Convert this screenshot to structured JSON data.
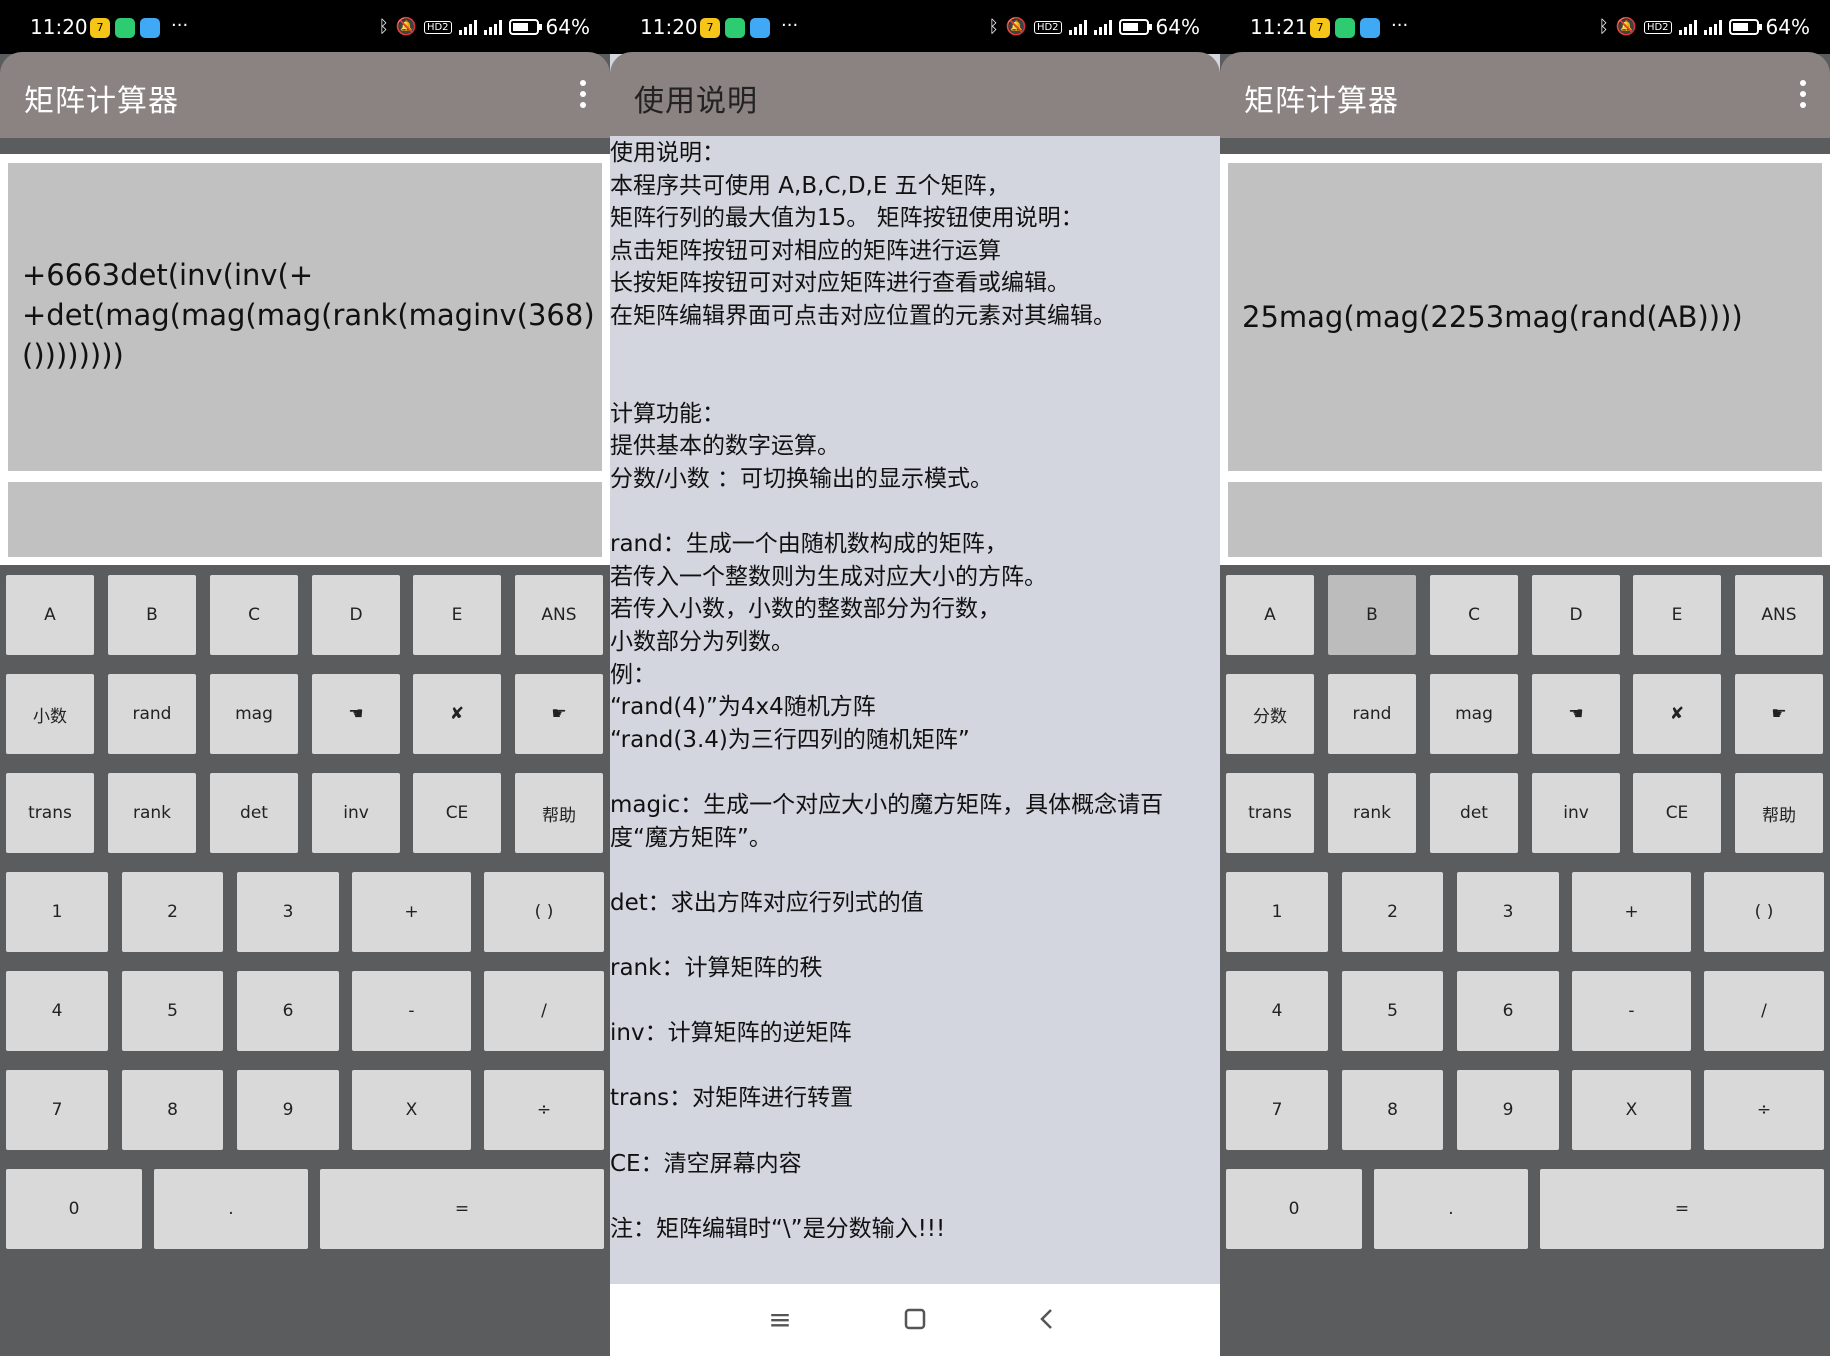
{
  "screens": [
    {
      "status": {
        "time": "11:20",
        "battery": "64%"
      },
      "title": "矩阵计算器",
      "expression": "+6663det(inv(inv(+\n+det(mag(mag(mag(rank(maginv(368)\n())))))))",
      "result": "",
      "keys": {
        "row1": [
          "A",
          "B",
          "C",
          "D",
          "E",
          "ANS"
        ],
        "row2": [
          "小数",
          "rand",
          "mag",
          "☚",
          "✘",
          "☛"
        ],
        "row3": [
          "trans",
          "rank",
          "det",
          "inv",
          "CE",
          "帮助"
        ],
        "row4": [
          "1",
          "2",
          "3",
          "+",
          "( )"
        ],
        "row5": [
          "4",
          "5",
          "6",
          "-",
          "/"
        ],
        "row6": [
          "7",
          "8",
          "9",
          "X",
          "÷"
        ],
        "row7": [
          "0",
          ".",
          "="
        ]
      }
    },
    {
      "status": {
        "time": "11:20",
        "battery": "64%"
      },
      "title": "使用说明",
      "lines": [
        "使用说明：",
        " 本程序共可使用 A,B,C,D,E 五个矩阵，",
        " 矩阵行列的最大值为15。  矩阵按钮使用说明：",
        " 点击矩阵按钮可对相应的矩阵进行运算",
        " 长按矩阵按钮可对对应矩阵进行查看或编辑。",
        " 在矩阵编辑界面可点击对应位置的元素对其编辑。",
        "",
        "",
        " 计算功能：",
        "   提供基本的数字运算。",
        "   分数/小数 ：可切换输出的显示模式。",
        "",
        "   rand：生成一个由随机数构成的矩阵，",
        "   若传入一个整数则为生成对应大小的方阵。",
        "   若传入小数，小数的整数部分为行数，",
        "   小数部分为列数。",
        "   例：",
        "   “rand(4)”为4x4随机方阵",
        "   “rand(3.4)为三行四列的随机矩阵”",
        "",
        "   magic：生成一个对应大小的魔方矩阵，具体概念请百",
        "度“魔方矩阵”。",
        "",
        "   det：求出方阵对应行列式的值",
        "",
        "   rank：计算矩阵的秩",
        "",
        "   inv：计算矩阵的逆矩阵",
        "",
        "   trans：对矩阵进行转置",
        "",
        "   CE：清空屏幕内容",
        "",
        " 注：矩阵编辑时“\\”是分数输入!!!"
      ]
    },
    {
      "status": {
        "time": "11:21",
        "battery": "64%"
      },
      "title": "矩阵计算器",
      "expression": "25mag(mag(2253mag(rand(AB))))",
      "result": "",
      "keys": {
        "row1": [
          "A",
          "B",
          "C",
          "D",
          "E",
          "ANS"
        ],
        "row2": [
          "分数",
          "rand",
          "mag",
          "☚",
          "✘",
          "☛"
        ],
        "row3": [
          "trans",
          "rank",
          "det",
          "inv",
          "CE",
          "帮助"
        ],
        "row4": [
          "1",
          "2",
          "3",
          "+",
          "( )"
        ],
        "row5": [
          "4",
          "5",
          "6",
          "-",
          "/"
        ],
        "row6": [
          "7",
          "8",
          "9",
          "X",
          "÷"
        ],
        "row7": [
          "0",
          ".",
          "="
        ]
      }
    }
  ],
  "colors": {
    "appbar": "#8b8282",
    "keyboard_bg": "#5b5c5e",
    "key": "#d9d9d9",
    "display": "#c1c1c1",
    "help_bg": "#d3d6df"
  }
}
